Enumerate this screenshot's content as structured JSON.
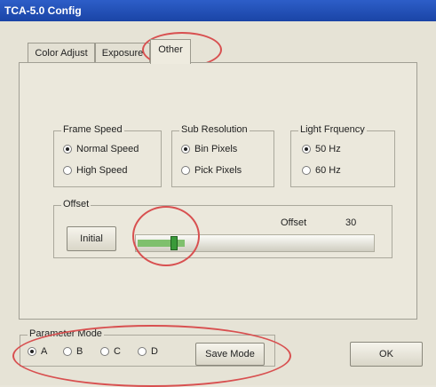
{
  "window": {
    "title": "TCA-5.0 Config"
  },
  "tabs": [
    {
      "label": "Color Adjust"
    },
    {
      "label": "Exposure"
    },
    {
      "label": "Other"
    }
  ],
  "frame_speed": {
    "title": "Frame Speed",
    "options": [
      "Normal Speed",
      "High Speed"
    ],
    "selected": "Normal Speed"
  },
  "sub_resolution": {
    "title": "Sub Resolution",
    "options": [
      "Bin Pixels",
      "Pick Pixels"
    ],
    "selected": "Bin Pixels"
  },
  "light_frequency": {
    "title": "Light Frquency",
    "options": [
      "50 Hz",
      "60 Hz"
    ],
    "selected": "50 Hz"
  },
  "offset": {
    "title": "Offset",
    "initial_button": "Initial",
    "value_label": "Offset",
    "value": "30",
    "slider_fraction": 0.2
  },
  "parameter_mode": {
    "title": "Parameter Mode",
    "options": [
      "A",
      "B",
      "C",
      "D"
    ],
    "selected": "A",
    "save_button": "Save Mode"
  },
  "ok_button": "OK",
  "colors": {
    "titlebar": "#1f4fb8",
    "annotation": "#d85050",
    "slider_thumb": "#3a9a3a"
  }
}
